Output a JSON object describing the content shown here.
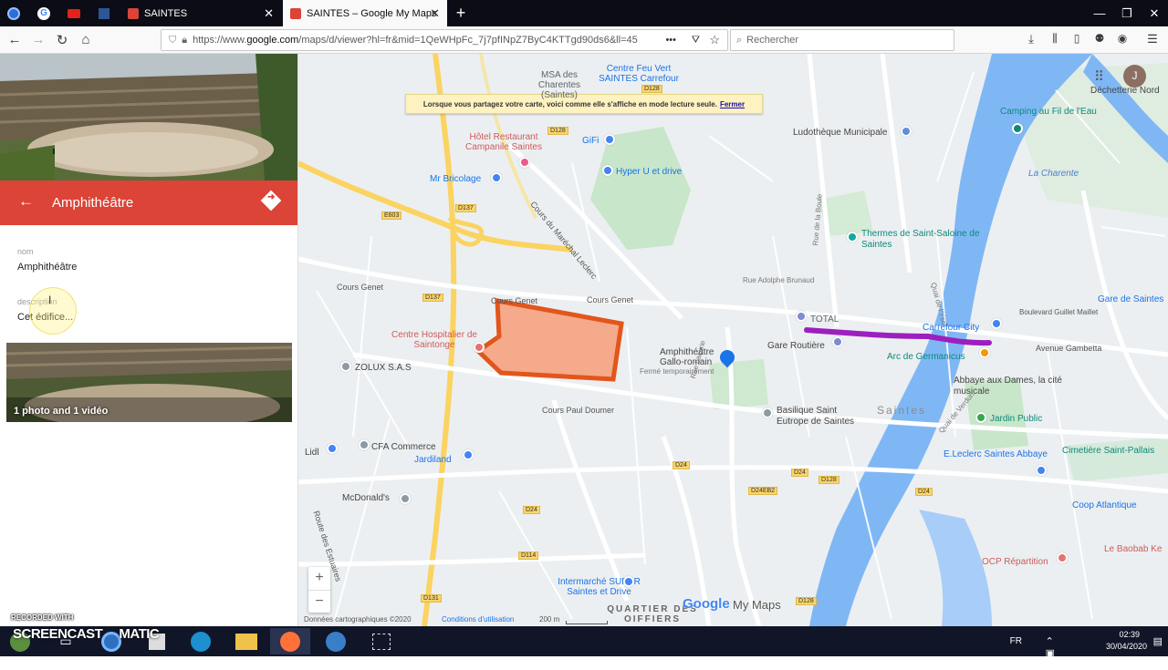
{
  "browser": {
    "tabs": [
      {
        "label": "SAINTES",
        "active": false
      },
      {
        "label": "SAINTES – Google My Maps",
        "active": true
      }
    ],
    "url_prefix": "https://www.",
    "url_domain": "google.com",
    "url_rest": "/maps/d/viewer?hl=fr&mid=1QeWHpFc_7j7pfINpZ7ByC4KTTgd90ds6&ll=45",
    "search_placeholder": "Rechercher",
    "new_tab": "+",
    "overflow": "•••"
  },
  "sidebar": {
    "title": "Amphithéâtre",
    "fields": {
      "nom_label": "nom",
      "nom_value": "Amphithéâtre",
      "description_label": "description",
      "description_value": "Cet édifice..."
    },
    "media_caption": "1 photo and 1 vidéo"
  },
  "map": {
    "banner_text": "Lorsque vous partagez votre carte, voici comme elle s'affiche en mode lecture seule.",
    "banner_link": "Fermer",
    "avatar_initial": "J",
    "labels": {
      "msa": "MSA des Charentes (Saintes)",
      "feu_vert": "Centre Feu Vert SAINTES Carrefour",
      "hotel": "Hôtel Restaurant Campanile Saintes",
      "gifi": "GiFi",
      "bricolage": "Mr Bricolage",
      "hyperu": "Hyper U et drive",
      "ludotheque": "Ludothèque Municipale",
      "decheterie": "Déchetterie Nord",
      "camping": "Camping au Fil de l'Eau",
      "charente": "La Charente",
      "thermes": "Thermes de Saint-Saloine de Saintes",
      "gare_saintes": "Gare de Saintes",
      "total": "TOTAL",
      "carrefour_city": "Carrefour City",
      "gare_routiere": "Gare Routière",
      "arc": "Arc de Germanicus",
      "abbaye": "Abbaye aux Dames, la cité musicale",
      "jardin": "Jardin Public",
      "basilique": "Basilique Saint Eutrope de Saintes",
      "saintes": "Saintes",
      "amphi": "Amphithéâtre Gallo-romain",
      "amphi_status": "Fermé temporairement",
      "hopital": "Centre Hospitalier de Saintonge",
      "zolux": "ZOLUX S.A.S",
      "lidl": "Lidl",
      "cfa": "CFA Commerce",
      "jardiland": "Jardiland",
      "mcdonalds": "McDonald's",
      "leclerc": "E.Leclerc Saintes Abbaye",
      "cimetiere": "Cimetière Saint-Pallais",
      "coop": "Coop Atlantique",
      "baobab": "Le Baobab Ke",
      "ocp": "OCP Répartition",
      "intermarche": "Intermarché SUPER Saintes et Drive",
      "quartier": "QUARTIER DES OIFFIERS",
      "cours_genet_1": "Cours Genet",
      "cours_genet_2": "Cours Genet",
      "cours_genet_3": "Cours Genet",
      "cours_paul_doumer": "Cours Paul Doumer",
      "cours_marechal": "Cours du Maréchal Leclerc",
      "avenue_gambetta": "Avenue Gambetta",
      "bd_guillet": "Boulevard Guillet Maillet",
      "route_estuaires": "Route des Estuaires",
      "rue_lacurie": "Rue Lacurie",
      "rue_boule": "Rue de la Boule",
      "rue_brunaud": "Rue Adolphe Brunaud",
      "quai_verdun": "Quai de Verdun",
      "quai_reparts": "Quai de l'Yser"
    },
    "shields": [
      "E603",
      "D137",
      "D137",
      "D128",
      "D128",
      "D128",
      "D24",
      "D24",
      "D24",
      "D24EB2",
      "D114",
      "D131",
      "D24",
      "D128",
      "D24",
      "D128"
    ],
    "zoom_in": "+",
    "zoom_out": "−",
    "footer": {
      "data": "Données cartographiques ©2020",
      "terms": "Conditions d'utilisation",
      "scale": "200 m"
    },
    "brand_google": "Google",
    "brand_mymaps": "My Maps"
  },
  "recording": {
    "recorded_with": "RECORDED WITH",
    "brand_a": "SCREENCAST",
    "brand_b": "MATIC"
  },
  "taskbar": {
    "language": "FR",
    "time": "02:39",
    "date": "30/04/2020"
  },
  "colors": {
    "header_red": "#db4437",
    "polygon_fill": "#f6a27f",
    "polygon_stroke": "#e2561b",
    "route_purple": "#9c1fbf",
    "pin_blue": "#1a73e8"
  }
}
